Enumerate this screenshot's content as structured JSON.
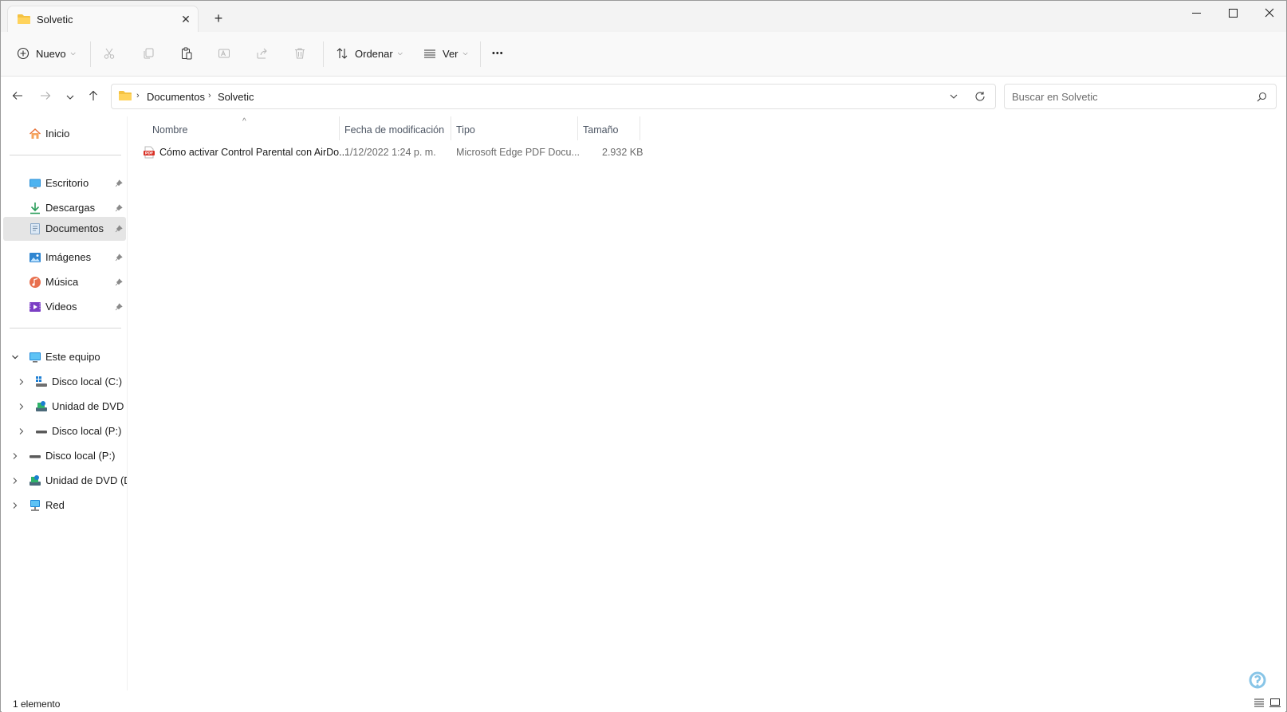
{
  "window": {
    "tab_title": "Solvetic",
    "new_tab_label": "+"
  },
  "toolbar": {
    "new_label": "Nuevo",
    "sort_label": "Ordenar",
    "view_label": "Ver",
    "more_label": "•••"
  },
  "address": {
    "breadcrumbs": [
      "Documentos",
      "Solvetic"
    ],
    "search_placeholder": "Buscar en Solvetic"
  },
  "nav": {
    "home": "Inicio",
    "quick": [
      {
        "label": "Escritorio",
        "icon": "desktop-icon"
      },
      {
        "label": "Descargas",
        "icon": "download-icon"
      },
      {
        "label": "Documentos",
        "icon": "documents-icon"
      },
      {
        "label": "Imágenes",
        "icon": "pictures-icon"
      },
      {
        "label": "Música",
        "icon": "music-icon"
      },
      {
        "label": "Videos",
        "icon": "videos-icon"
      }
    ],
    "this_pc": "Este equipo",
    "pc_children": [
      "Disco local (C:)",
      "Unidad de DVD (D",
      "Disco local (P:)"
    ],
    "top_level": [
      "Disco local (P:)",
      "Unidad de DVD (D:)",
      "Red"
    ]
  },
  "columns": {
    "name": "Nombre",
    "date": "Fecha de modificación",
    "type": "Tipo",
    "size": "Tamaño"
  },
  "files": [
    {
      "name": "Cómo activar Control Parental con AirDo...",
      "date": "1/12/2022 1:24 p. m.",
      "type": "Microsoft Edge PDF Docu...",
      "size": "2.932 KB",
      "icon_text": "PDF"
    }
  ],
  "status": {
    "count": "1 elemento"
  },
  "colors": {
    "accent": "#0067c0",
    "folder": "#f4c242",
    "selected": "#e5e5e5"
  }
}
